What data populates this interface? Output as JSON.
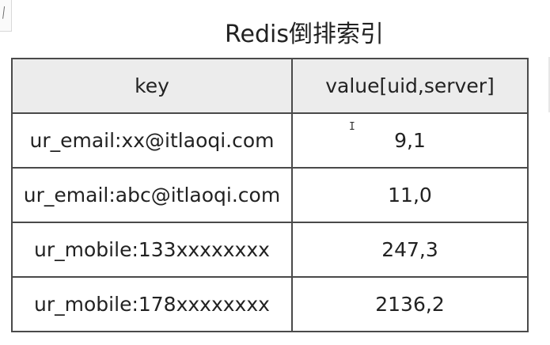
{
  "title": "Redis倒排索引",
  "table": {
    "headers": [
      "key",
      "value[uid,server]"
    ],
    "rows": [
      [
        "ur_email:xx@itlaoqi.com",
        "9,1"
      ],
      [
        "ur_email:abc@itlaoqi.com",
        "11,0"
      ],
      [
        "ur_mobile:133xxxxxxxx",
        "247,3"
      ],
      [
        "ur_mobile:178xxxxxxxx",
        "2136,2"
      ]
    ]
  },
  "cursor_glyph": "I"
}
